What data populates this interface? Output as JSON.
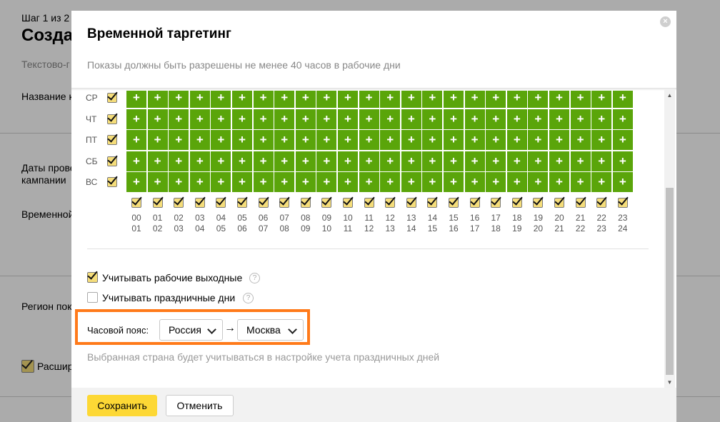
{
  "background": {
    "step": "Шаг 1 из 2",
    "title_fragment": "Созда",
    "subtitle_fragment": "Текстово-г",
    "labels": [
      "Название к",
      "Даты прове",
      "кампании",
      "Временной",
      "Регион пок",
      "Расшир"
    ]
  },
  "modal": {
    "title": "Временной таргетинг",
    "subtitle": "Показы должны быть разрешены не менее 40 часов в рабочие дни",
    "days": [
      "СР",
      "ЧТ",
      "ПТ",
      "СБ",
      "ВС"
    ],
    "hours_start": [
      "00",
      "01",
      "02",
      "03",
      "04",
      "05",
      "06",
      "07",
      "08",
      "09",
      "10",
      "11",
      "12",
      "13",
      "14",
      "15",
      "16",
      "17",
      "18",
      "19",
      "20",
      "21",
      "22",
      "23"
    ],
    "hours_end": [
      "01",
      "02",
      "03",
      "04",
      "05",
      "06",
      "07",
      "08",
      "09",
      "10",
      "11",
      "12",
      "13",
      "14",
      "15",
      "16",
      "17",
      "18",
      "19",
      "20",
      "21",
      "22",
      "23",
      "24"
    ],
    "cell_symbol": "+",
    "options": [
      {
        "label": "Учитывать рабочие выходные",
        "checked": true
      },
      {
        "label": "Учитывать праздничные дни",
        "checked": false
      }
    ],
    "help_symbol": "?",
    "timezone": {
      "label": "Часовой пояс:",
      "country": "Россия",
      "arrow": "→",
      "city": "Москва"
    },
    "note": "Выбранная страна будет учитываться в настройке учета праздничных дней",
    "save_label": "Сохранить",
    "cancel_label": "Отменить",
    "close_symbol": "×"
  },
  "colors": {
    "cell_green": "#5aa50a",
    "checkbox_yellow": "#f5dd7a",
    "highlight_orange": "#ff7a1a",
    "save_yellow": "#fdd835"
  }
}
